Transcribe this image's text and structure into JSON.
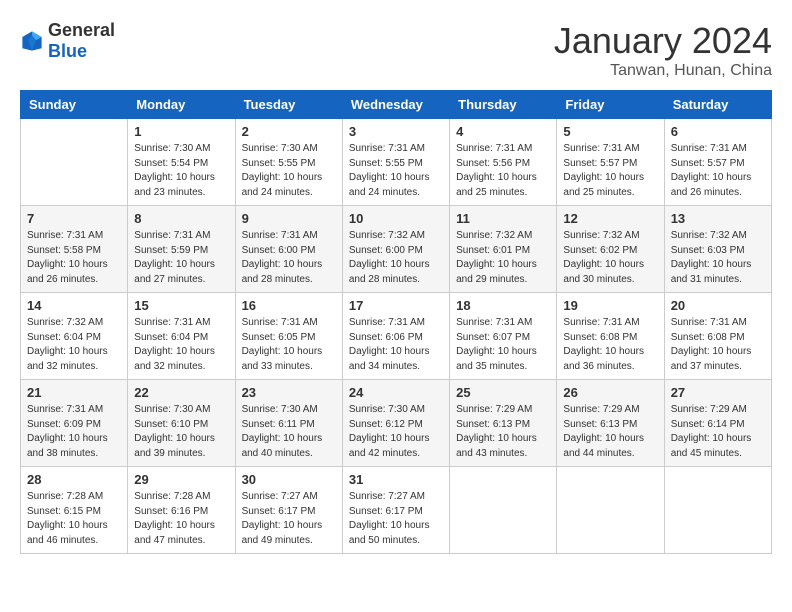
{
  "logo": {
    "general": "General",
    "blue": "Blue"
  },
  "header": {
    "month": "January 2024",
    "location": "Tanwan, Hunan, China"
  },
  "weekdays": [
    "Sunday",
    "Monday",
    "Tuesday",
    "Wednesday",
    "Thursday",
    "Friday",
    "Saturday"
  ],
  "weeks": [
    [
      {
        "day": "",
        "sunrise": "",
        "sunset": "",
        "daylight": ""
      },
      {
        "day": "1",
        "sunrise": "Sunrise: 7:30 AM",
        "sunset": "Sunset: 5:54 PM",
        "daylight": "Daylight: 10 hours and 23 minutes."
      },
      {
        "day": "2",
        "sunrise": "Sunrise: 7:30 AM",
        "sunset": "Sunset: 5:55 PM",
        "daylight": "Daylight: 10 hours and 24 minutes."
      },
      {
        "day": "3",
        "sunrise": "Sunrise: 7:31 AM",
        "sunset": "Sunset: 5:55 PM",
        "daylight": "Daylight: 10 hours and 24 minutes."
      },
      {
        "day": "4",
        "sunrise": "Sunrise: 7:31 AM",
        "sunset": "Sunset: 5:56 PM",
        "daylight": "Daylight: 10 hours and 25 minutes."
      },
      {
        "day": "5",
        "sunrise": "Sunrise: 7:31 AM",
        "sunset": "Sunset: 5:57 PM",
        "daylight": "Daylight: 10 hours and 25 minutes."
      },
      {
        "day": "6",
        "sunrise": "Sunrise: 7:31 AM",
        "sunset": "Sunset: 5:57 PM",
        "daylight": "Daylight: 10 hours and 26 minutes."
      }
    ],
    [
      {
        "day": "7",
        "sunrise": "Sunrise: 7:31 AM",
        "sunset": "Sunset: 5:58 PM",
        "daylight": "Daylight: 10 hours and 26 minutes."
      },
      {
        "day": "8",
        "sunrise": "Sunrise: 7:31 AM",
        "sunset": "Sunset: 5:59 PM",
        "daylight": "Daylight: 10 hours and 27 minutes."
      },
      {
        "day": "9",
        "sunrise": "Sunrise: 7:31 AM",
        "sunset": "Sunset: 6:00 PM",
        "daylight": "Daylight: 10 hours and 28 minutes."
      },
      {
        "day": "10",
        "sunrise": "Sunrise: 7:32 AM",
        "sunset": "Sunset: 6:00 PM",
        "daylight": "Daylight: 10 hours and 28 minutes."
      },
      {
        "day": "11",
        "sunrise": "Sunrise: 7:32 AM",
        "sunset": "Sunset: 6:01 PM",
        "daylight": "Daylight: 10 hours and 29 minutes."
      },
      {
        "day": "12",
        "sunrise": "Sunrise: 7:32 AM",
        "sunset": "Sunset: 6:02 PM",
        "daylight": "Daylight: 10 hours and 30 minutes."
      },
      {
        "day": "13",
        "sunrise": "Sunrise: 7:32 AM",
        "sunset": "Sunset: 6:03 PM",
        "daylight": "Daylight: 10 hours and 31 minutes."
      }
    ],
    [
      {
        "day": "14",
        "sunrise": "Sunrise: 7:32 AM",
        "sunset": "Sunset: 6:04 PM",
        "daylight": "Daylight: 10 hours and 32 minutes."
      },
      {
        "day": "15",
        "sunrise": "Sunrise: 7:31 AM",
        "sunset": "Sunset: 6:04 PM",
        "daylight": "Daylight: 10 hours and 32 minutes."
      },
      {
        "day": "16",
        "sunrise": "Sunrise: 7:31 AM",
        "sunset": "Sunset: 6:05 PM",
        "daylight": "Daylight: 10 hours and 33 minutes."
      },
      {
        "day": "17",
        "sunrise": "Sunrise: 7:31 AM",
        "sunset": "Sunset: 6:06 PM",
        "daylight": "Daylight: 10 hours and 34 minutes."
      },
      {
        "day": "18",
        "sunrise": "Sunrise: 7:31 AM",
        "sunset": "Sunset: 6:07 PM",
        "daylight": "Daylight: 10 hours and 35 minutes."
      },
      {
        "day": "19",
        "sunrise": "Sunrise: 7:31 AM",
        "sunset": "Sunset: 6:08 PM",
        "daylight": "Daylight: 10 hours and 36 minutes."
      },
      {
        "day": "20",
        "sunrise": "Sunrise: 7:31 AM",
        "sunset": "Sunset: 6:08 PM",
        "daylight": "Daylight: 10 hours and 37 minutes."
      }
    ],
    [
      {
        "day": "21",
        "sunrise": "Sunrise: 7:31 AM",
        "sunset": "Sunset: 6:09 PM",
        "daylight": "Daylight: 10 hours and 38 minutes."
      },
      {
        "day": "22",
        "sunrise": "Sunrise: 7:30 AM",
        "sunset": "Sunset: 6:10 PM",
        "daylight": "Daylight: 10 hours and 39 minutes."
      },
      {
        "day": "23",
        "sunrise": "Sunrise: 7:30 AM",
        "sunset": "Sunset: 6:11 PM",
        "daylight": "Daylight: 10 hours and 40 minutes."
      },
      {
        "day": "24",
        "sunrise": "Sunrise: 7:30 AM",
        "sunset": "Sunset: 6:12 PM",
        "daylight": "Daylight: 10 hours and 42 minutes."
      },
      {
        "day": "25",
        "sunrise": "Sunrise: 7:29 AM",
        "sunset": "Sunset: 6:13 PM",
        "daylight": "Daylight: 10 hours and 43 minutes."
      },
      {
        "day": "26",
        "sunrise": "Sunrise: 7:29 AM",
        "sunset": "Sunset: 6:13 PM",
        "daylight": "Daylight: 10 hours and 44 minutes."
      },
      {
        "day": "27",
        "sunrise": "Sunrise: 7:29 AM",
        "sunset": "Sunset: 6:14 PM",
        "daylight": "Daylight: 10 hours and 45 minutes."
      }
    ],
    [
      {
        "day": "28",
        "sunrise": "Sunrise: 7:28 AM",
        "sunset": "Sunset: 6:15 PM",
        "daylight": "Daylight: 10 hours and 46 minutes."
      },
      {
        "day": "29",
        "sunrise": "Sunrise: 7:28 AM",
        "sunset": "Sunset: 6:16 PM",
        "daylight": "Daylight: 10 hours and 47 minutes."
      },
      {
        "day": "30",
        "sunrise": "Sunrise: 7:27 AM",
        "sunset": "Sunset: 6:17 PM",
        "daylight": "Daylight: 10 hours and 49 minutes."
      },
      {
        "day": "31",
        "sunrise": "Sunrise: 7:27 AM",
        "sunset": "Sunset: 6:17 PM",
        "daylight": "Daylight: 10 hours and 50 minutes."
      },
      {
        "day": "",
        "sunrise": "",
        "sunset": "",
        "daylight": ""
      },
      {
        "day": "",
        "sunrise": "",
        "sunset": "",
        "daylight": ""
      },
      {
        "day": "",
        "sunrise": "",
        "sunset": "",
        "daylight": ""
      }
    ]
  ]
}
